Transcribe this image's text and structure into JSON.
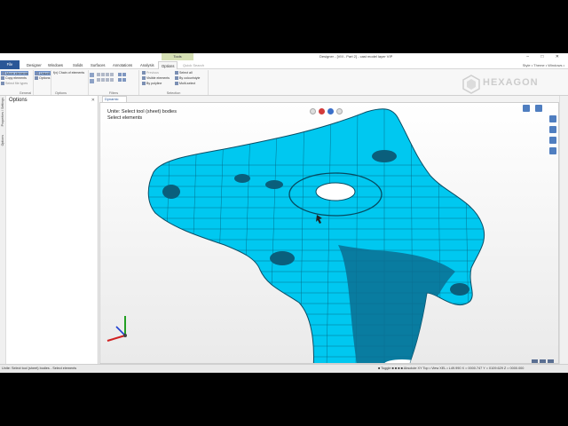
{
  "titlebar": {
    "context_tab": "Tools",
    "title": "Designer - [VIII - Part 2] - cast model layer VIP",
    "window_buttons": "– □ ✕"
  },
  "tabs": {
    "file": "File",
    "items": [
      "Designer",
      "Windows",
      "Solids",
      "Surfaces",
      "Annotations",
      "Analysis",
      "Options"
    ],
    "active_index": 6,
    "search": "Quick Search",
    "right": "Style • Theme • Windows •"
  },
  "ribbon": {
    "general": {
      "label": "General",
      "items": [
        "Move elements",
        "Copy elements",
        "Select file types"
      ]
    },
    "options": {
      "label": "Options",
      "items": [
        "Uniunit",
        "Options"
      ],
      "chain": "f(x) Chain of elements"
    },
    "filters": {
      "label": "Filters"
    },
    "selection": {
      "label": "Selection",
      "left": [
        "Previous",
        "Visible elements",
        "By polyline"
      ],
      "right": [
        "Select all",
        "By colour/style",
        "Multi-select"
      ]
    }
  },
  "logo": {
    "text": "HEXAGON"
  },
  "left_panel": {
    "title": "Options",
    "vertical_tabs": [
      "Properties / Settings",
      "Options"
    ]
  },
  "viewport": {
    "tab": "Dynamic",
    "prompt_line1": "Unite: Select tool (sheet) bodies",
    "prompt_line2": "Select elements",
    "model_color": "#00c8f0"
  },
  "status": {
    "left": "Unite: Select tool (sheet) bodies - Select elements",
    "right": "■ Toggle ■ ■ ■ ■  Absolute XY Top • View XEL • L49.990  X = 0000.747  Y = 0109.629  Z = 0000.000"
  }
}
